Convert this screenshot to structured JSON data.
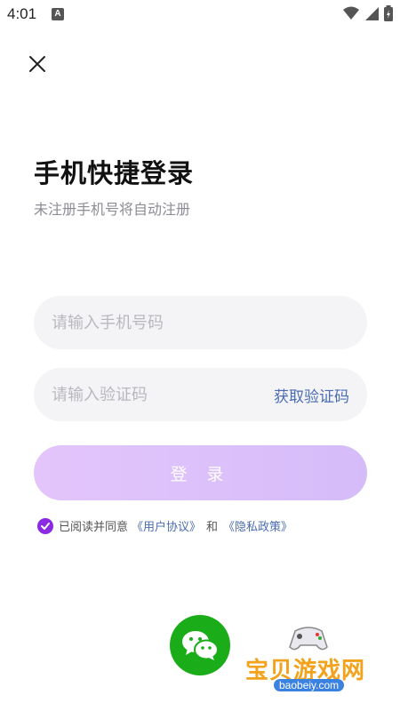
{
  "status_bar": {
    "time": "4:01",
    "notif_icon": "A"
  },
  "close": {
    "icon": "close-icon"
  },
  "header": {
    "title": "手机快捷登录",
    "subtitle": "未注册手机号将自动注册"
  },
  "phone_input": {
    "value": "",
    "placeholder": "请输入手机号码"
  },
  "code_input": {
    "value": "",
    "placeholder": "请输入验证码",
    "get_code_label": "获取验证码"
  },
  "login": {
    "label": "登 录",
    "color_start": "#e3c5fb",
    "color_end": "#d5bcf9"
  },
  "agreement": {
    "checked": true,
    "prefix": "已阅读并同意",
    "user_agreement": "《用户协议》",
    "and": "和",
    "privacy_policy": "《隐私政策》"
  },
  "wechat": {
    "icon": "wechat-icon",
    "color": "#1aad19"
  },
  "watermark": {
    "text": "宝贝游戏网",
    "url": "baobeiy.com"
  }
}
